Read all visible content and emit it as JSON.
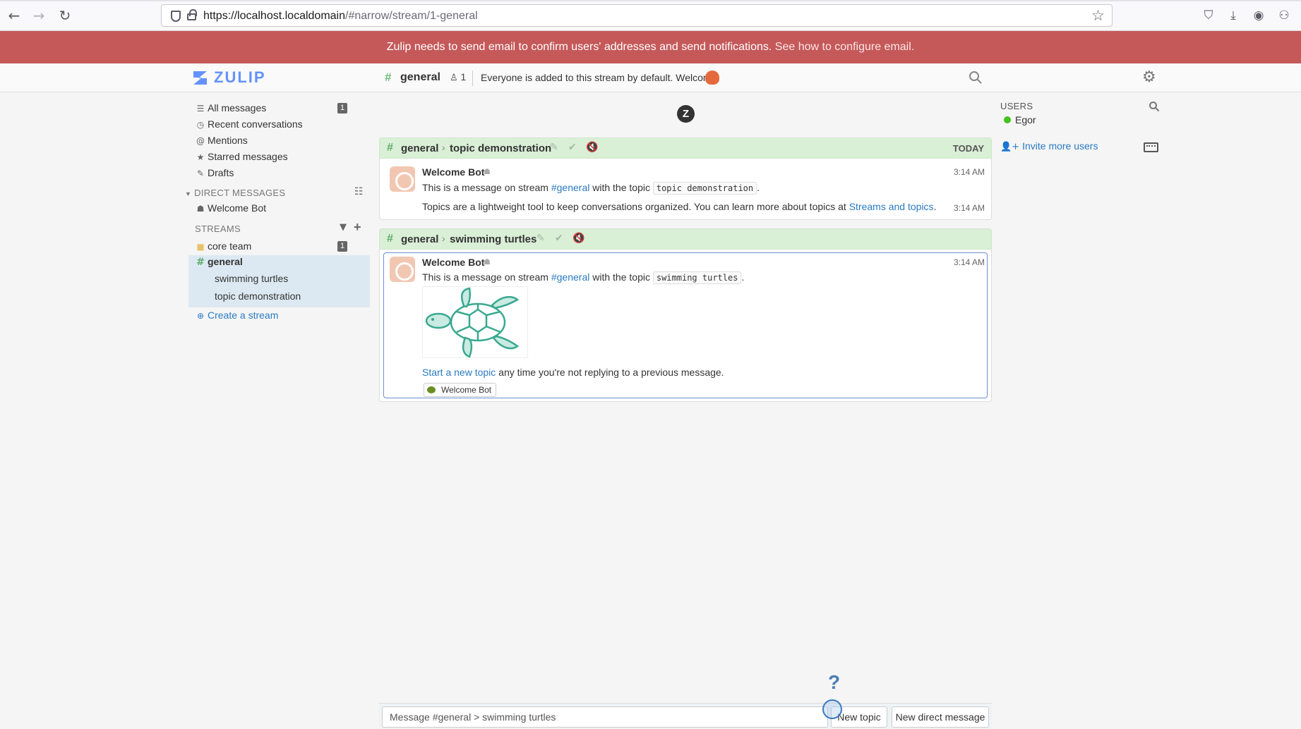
{
  "browser": {
    "url_host": "https://localhost.localdomain",
    "url_path": "/#narrow/stream/1-general"
  },
  "alert": {
    "text": "Zulip needs to send email to confirm users' addresses and send notifications.",
    "link": "See how to configure email."
  },
  "header": {
    "logo_text": "ZULIP",
    "stream": "general",
    "subscriber_count": "1",
    "description": "Everyone is added to this stream by default. Welcome!"
  },
  "left_sidebar": {
    "views": [
      {
        "label": "All messages",
        "icon": "all-messages-icon",
        "badge": "1"
      },
      {
        "label": "Recent conversations",
        "icon": "clock-icon"
      },
      {
        "label": "Mentions",
        "icon": "at-icon"
      },
      {
        "label": "Starred messages",
        "icon": "star-icon"
      },
      {
        "label": "Drafts",
        "icon": "pencil-icon"
      }
    ],
    "dm_header": "DIRECT MESSAGES",
    "dm_items": [
      "Welcome Bot"
    ],
    "streams_header": "STREAMS",
    "streams": [
      {
        "name": "core team",
        "badge": "1"
      },
      {
        "name": "general"
      }
    ],
    "topics": [
      "swimming turtles",
      "topic demonstration"
    ],
    "create_stream": "Create a stream"
  },
  "feed": {
    "groups": [
      {
        "stream": "general",
        "topic": "topic demonstration",
        "date": "TODAY",
        "sender": "Welcome Bot",
        "time1": "3:14 AM",
        "time2": "3:14 AM",
        "line1_pre": "This is a message on stream",
        "line1_stream": "#general",
        "line1_mid": "with the topic",
        "line1_code": "topic demonstration",
        "line2_pre": "Topics are a lightweight tool to keep conversations organized. You can learn more about topics at",
        "line2_link": "Streams and topics"
      },
      {
        "stream": "general",
        "topic": "swimming turtles",
        "sender": "Welcome Bot",
        "time1": "3:14 AM",
        "line1_pre": "This is a message on stream",
        "line1_stream": "#general",
        "line1_mid": "with the topic",
        "line1_code": "swimming turtles",
        "line2_link": "Start a new topic",
        "line2_rest": "any time you're not replying to a previous message.",
        "reaction_label": "Welcome Bot"
      }
    ]
  },
  "right_sidebar": {
    "title": "USERS",
    "users": [
      {
        "name": "Egor",
        "status_color": "#44c21d"
      }
    ],
    "invite": "Invite more users"
  },
  "compose": {
    "help": "?",
    "placeholder": "Message #general > swimming turtles",
    "new_topic": "New topic",
    "new_dm": "New direct message"
  },
  "colors": {
    "alert_bg": "#c5595a",
    "recipient_bar": "#d9efd6",
    "link": "#2a7ac2",
    "logo": "#6492fd"
  }
}
